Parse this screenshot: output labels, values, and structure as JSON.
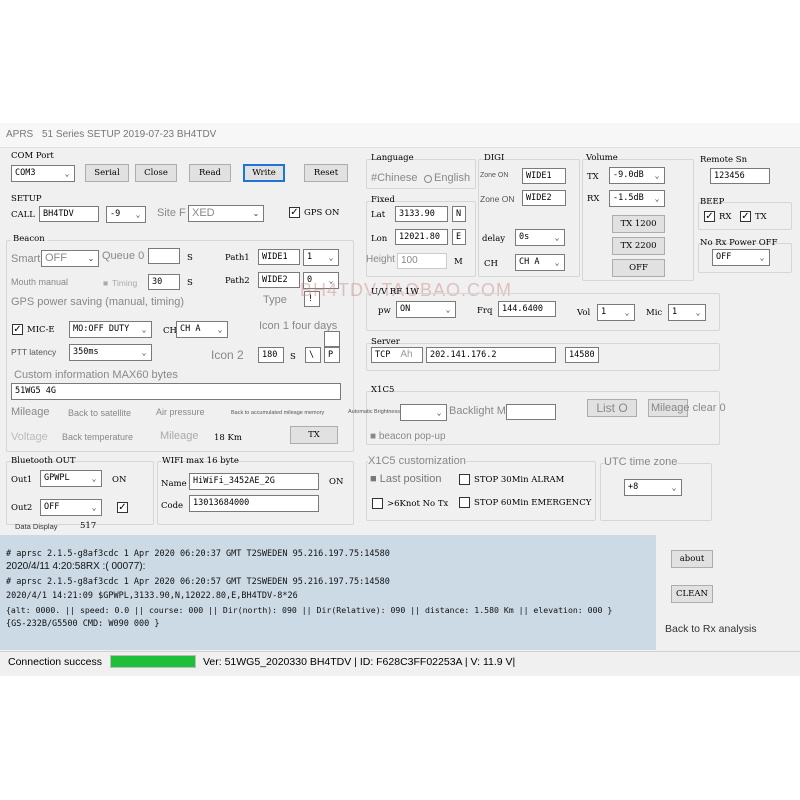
{
  "title": {
    "app": "APRS",
    "rest": "51 Series SETUP 2019-07-23 BH4TDV"
  },
  "com": {
    "label": "COM Port",
    "port": "COM3",
    "serial": "Serial",
    "close": "Close",
    "read": "Read",
    "write": "Write",
    "reset": "Reset"
  },
  "setup": {
    "label": "SETUP",
    "call_label": "CALL",
    "call": "BH4TDV",
    "ssid": "-9",
    "site_label": "Site F",
    "site_value": "XED",
    "gps_on": "GPS ON"
  },
  "beacon": {
    "label": "Beacon",
    "smart_label": "Smart",
    "smart_value": "OFF",
    "queue_label": "Queue 0",
    "queue_unit": "S",
    "mouth_manual": "Mouth manual",
    "timing": "Timing",
    "timing_value": "30",
    "timing_unit": "S",
    "gps_power": "GPS power saving (manual, timing)",
    "path1_label": "Path1",
    "path1": "WIDE1",
    "path1_n": "1",
    "path2_label": "Path2",
    "path2": "WIDE2",
    "path2_n": "0",
    "type_label": "Type",
    "type_value": "!",
    "mice_label": "MIC-E",
    "mice_value": "MO:OFF DUTY",
    "ch_label": "CH",
    "ch_value": "CH A",
    "icon1": "Icon 1 four days",
    "ptt_latency": "PTT latency",
    "ptt_value": "350ms",
    "icon2": "Icon 2",
    "icon2_value": "180",
    "icon2_unit": "S",
    "icon2_sym1": "\\",
    "icon2_sym2": "P",
    "custom_label": "Custom information MAX60 bytes",
    "custom_value": "51WG5 4G",
    "mileage": "Mileage",
    "back_satellite": "Back to satellite",
    "air_pressure": "Air pressure",
    "back_mileage_memory": "Back to accumulated mileage memory",
    "voltage": "Voltage",
    "back_temperature": "Back temperature",
    "mileage2": "Mileage",
    "mileage_value": "18 Km",
    "tx": "TX"
  },
  "language": {
    "label": "Language",
    "chinese": "#Chinese",
    "english": "English"
  },
  "fixed": {
    "label": "Fixed",
    "lat_label": "Lat",
    "lat": "3133.90",
    "lat_dir": "N",
    "lon_label": "Lon",
    "lon": "12021.80",
    "lon_dir": "E",
    "height_label": "Height",
    "height": "100",
    "height_unit": "M"
  },
  "digi": {
    "label": "DIGI",
    "zone1_label": "Zone ON",
    "zone1": "WIDE1",
    "zone2_label": "Zone ON",
    "zone2": "WIDE2",
    "delay_label": "delay",
    "delay": "0s",
    "ch_label": "CH",
    "ch": "CH A"
  },
  "volume": {
    "label": "Volume",
    "tx_label": "TX",
    "tx": "-9.0dB",
    "rx_label": "RX",
    "rx": "-1.5dB",
    "tx1200": "TX 1200",
    "tx2200": "TX 2200",
    "off": "OFF"
  },
  "remote": {
    "label": "Remote Sn",
    "value": "123456"
  },
  "beep": {
    "label": "BEEP",
    "rx": "RX",
    "tx": "TX"
  },
  "no_rx": {
    "label": "No Rx Power OFF",
    "value": "OFF"
  },
  "uv": {
    "label": "U/V RF 1W",
    "pw_label": "pw",
    "pw": "ON",
    "frq_label": "Frq",
    "frq": "144.6400",
    "vol_label": "Vol",
    "vol": "1",
    "mic_label": "Mic",
    "mic": "1"
  },
  "watermark": "BH4TDV.TAOBAO.COM",
  "server": {
    "label": "Server",
    "proto": "TCP",
    "ah": "Ah",
    "ip": "202.141.176.2",
    "port": "14580"
  },
  "x1c5": {
    "label": "X1C5",
    "backlight": "Backlight Min @",
    "list": "List O",
    "mileage_clear": "Mileage clear 0",
    "beacon_popup": "beacon pop-up"
  },
  "bluetooth": {
    "label": "Bluetooth OUT",
    "out1_label": "Out1",
    "out1": "GPWPL",
    "on": "ON",
    "out2_label": "Out2",
    "out2": "OFF",
    "data_display": "Data Display",
    "data_value": "517"
  },
  "wifi": {
    "label": "WIFI max 16 byte",
    "name_label": "Name",
    "name": "HiWiFi_3452AE_2G",
    "on": "ON",
    "code_label": "Code",
    "code": "13013684000"
  },
  "custom": {
    "label": "X1C5 customization",
    "last_position": "Last position",
    "stop30": "STOP 30Min ALRAM",
    "knot": ">6Knot No Tx",
    "stop60": "STOP 60Min EMERGENCY"
  },
  "utc": {
    "label": "UTC time zone",
    "value": "+8"
  },
  "log": {
    "lines": [
      "# aprsc 2.1.5-g8af3cdc 1 Apr 2020 06:20:37 GMT T2SWEDEN 95.216.197.75:14580",
      "2020/4/11 4:20:58RX :( 00077):",
      "# aprsc 2.1.5-g8af3cdc 1 Apr 2020 06:20:57 GMT T2SWEDEN 95.216.197.75:14580",
      "2020/4/1 14:21:09  $GPWPL,3133.90,N,12022.80,E,BH4TDV-8*26",
      "{alt:  0000. || speed: 0.0 || course: 000 || Dir(north): 090 || Dir(Relative): 090 || distance: 1.580 Km  || elevation: 000 }",
      "{GS-232B/G5500 CMD: W090 000 }"
    ]
  },
  "side": {
    "about": "about",
    "clean": "CLEAN",
    "back_rx": "Back to Rx analysis"
  },
  "status": {
    "connection": "Connection success",
    "progress": 1.0,
    "version": "Ver: 51WG5_2020330 BH4TDV | ID: F628C3FF02253A | V: 11.9 V|"
  },
  "colors": {
    "progress": "#1fbf3a",
    "log_bg": "#ccdae6",
    "focus": "#1e75d6"
  }
}
